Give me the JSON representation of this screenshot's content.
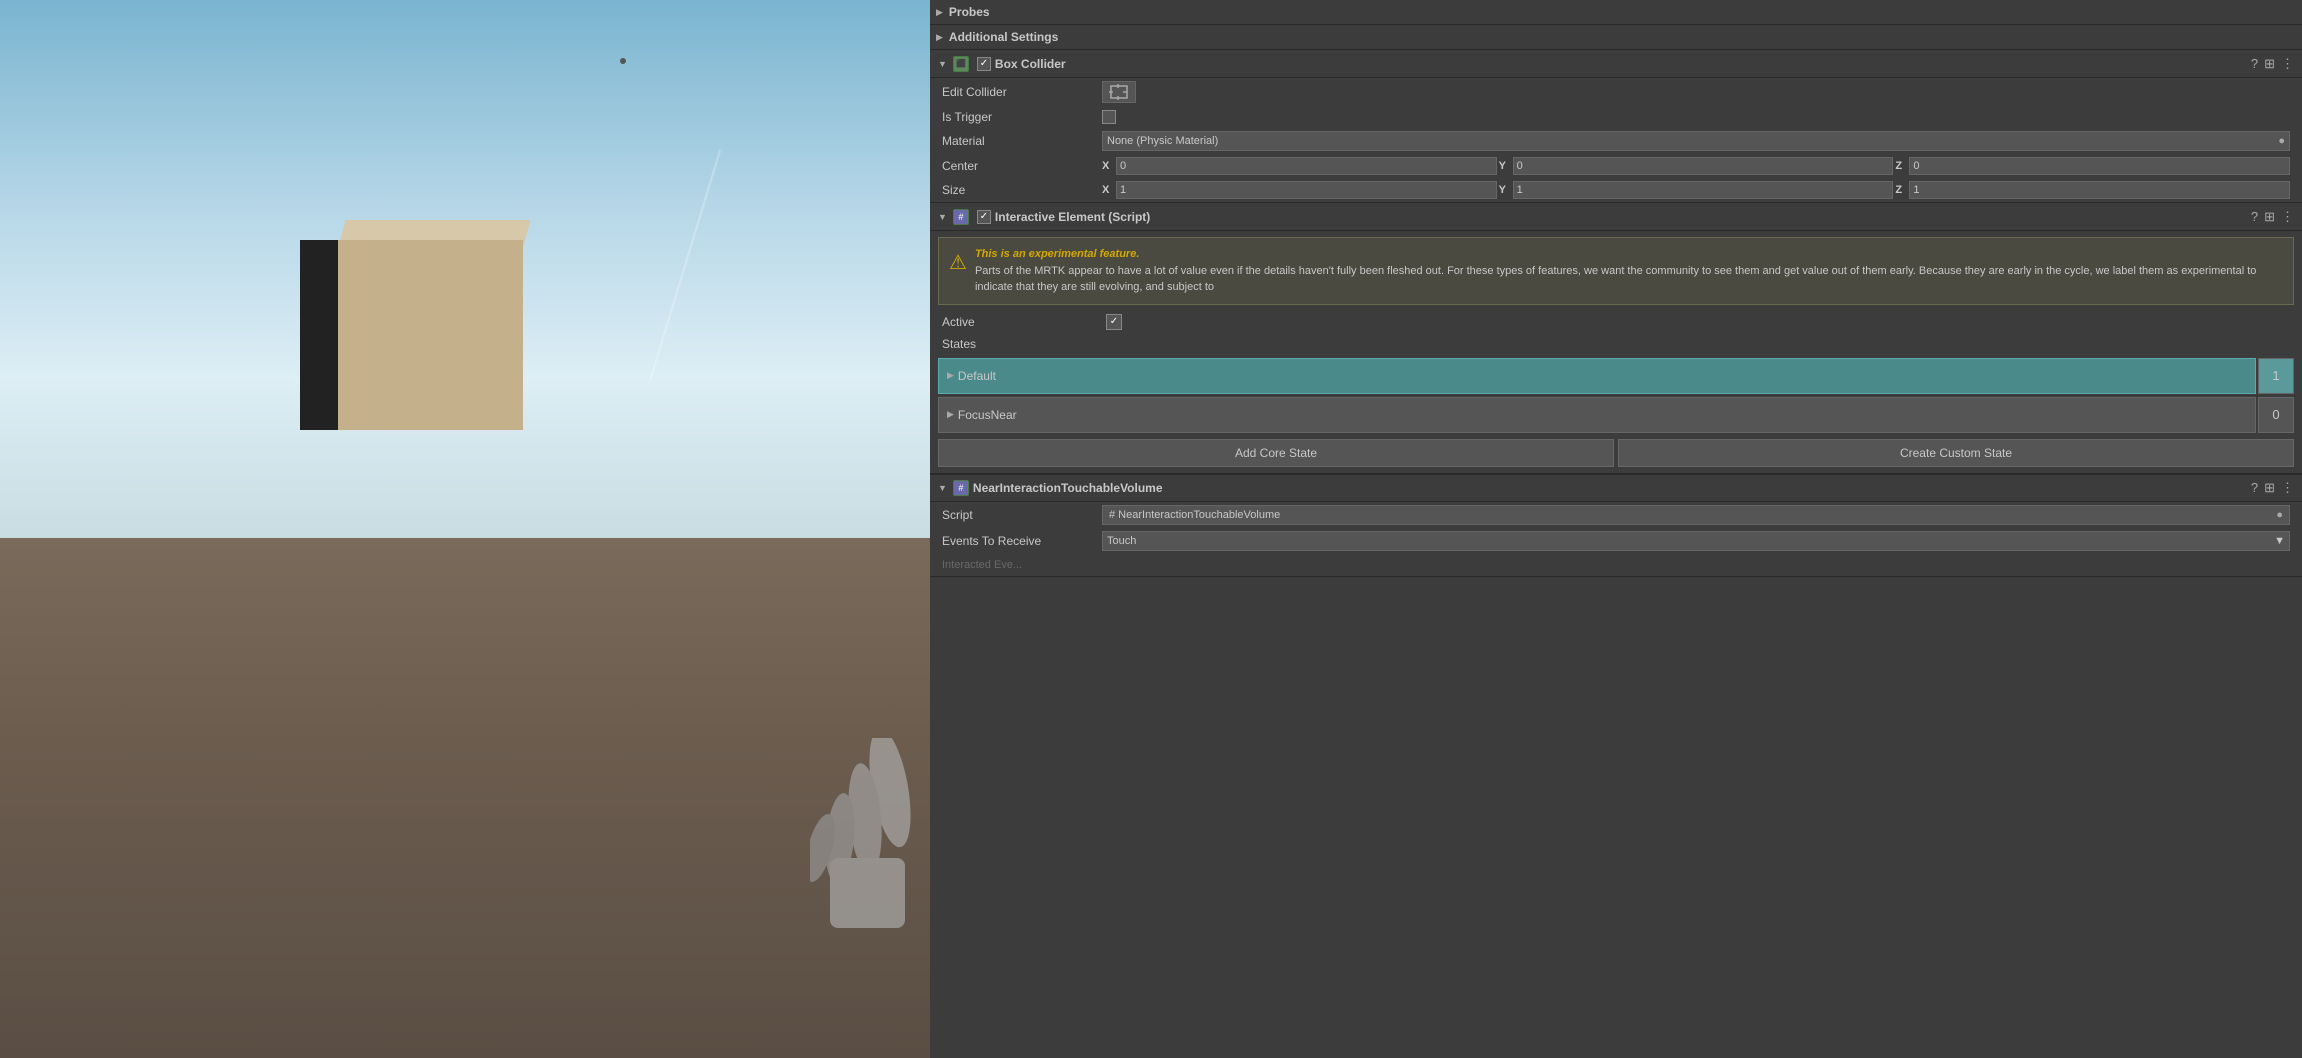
{
  "viewport": {
    "label": "Scene Viewport"
  },
  "inspector": {
    "probes": {
      "label": "Probes"
    },
    "additional_settings": {
      "label": "Additional Settings"
    },
    "box_collider": {
      "title": "Box Collider",
      "edit_collider_label": "Edit Collider",
      "is_trigger_label": "Is Trigger",
      "material_label": "Material",
      "material_value": "None (Physic Material)",
      "center_label": "Center",
      "center_x": "0",
      "center_y": "0",
      "center_z": "0",
      "size_label": "Size",
      "size_x": "1",
      "size_y": "1",
      "size_z": "1",
      "x_label": "X",
      "y_label": "Y",
      "z_label": "Z"
    },
    "interactive_element": {
      "title": "Interactive Element (Script)",
      "warning_title": "This is an experimental feature.",
      "warning_body": "Parts of the MRTK appear to have a lot of value even if the details haven't fully been fleshed out. For these types of features, we want the community to see them and get value out of them early. Because they are early in the cycle, we label them as experimental to indicate that they are still evolving, and subject to",
      "active_label": "Active",
      "states_label": "States",
      "default_state": "Default",
      "default_count": "1",
      "focusnear_state": "FocusNear",
      "focusnear_count": "0",
      "add_core_state_label": "Add Core State",
      "create_custom_state_label": "Create Custom State"
    },
    "near_interaction": {
      "title": "NearInteractionTouchableVolume",
      "script_label": "Script",
      "script_value": "# NearInteractionTouchableVolume",
      "events_label": "Events To Receive",
      "events_value": "Touch",
      "dropdown_arrow": "▼"
    }
  }
}
